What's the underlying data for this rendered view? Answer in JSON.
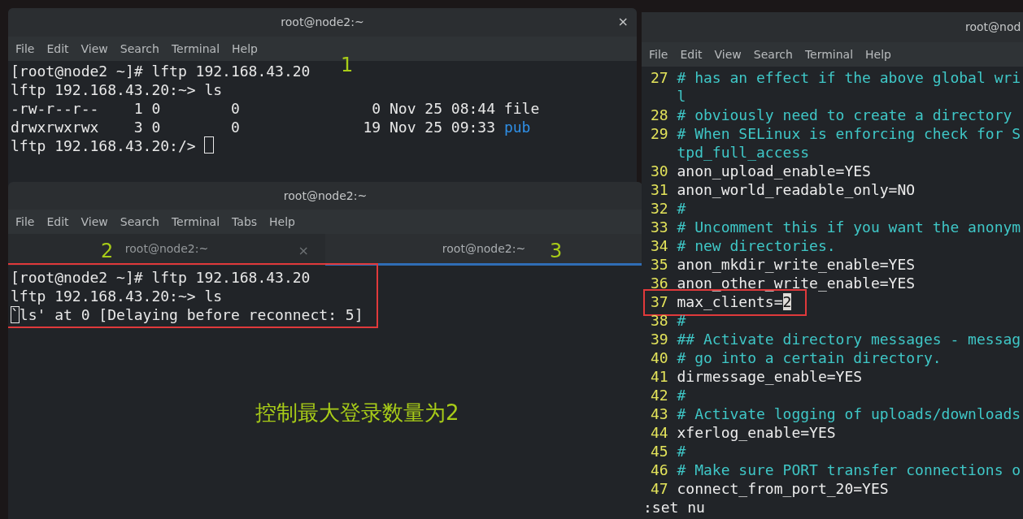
{
  "terminal_window_1": {
    "title": "root@node2:~",
    "close": "×",
    "menu": [
      "File",
      "Edit",
      "View",
      "Search",
      "Terminal",
      "Help"
    ],
    "annotation": "1",
    "lines": [
      {
        "segments": [
          {
            "text": "[root@node2 ~]# lftp 192.168.43.20",
            "kind": "plain"
          }
        ]
      },
      {
        "segments": [
          {
            "text": "lftp 192.168.43.20:~> ls",
            "kind": "plain"
          }
        ]
      },
      {
        "segments": [
          {
            "text": "-rw-r--r--    1 0        0               0 Nov 25 08:44 file",
            "kind": "plain"
          }
        ]
      },
      {
        "segments": [
          {
            "text": "drwxrwxrwx    3 0        0              19 Nov 25 09:33 ",
            "kind": "plain"
          },
          {
            "text": "pub",
            "kind": "dir"
          }
        ]
      },
      {
        "segments": [
          {
            "text": "lftp 192.168.43.20:/> ",
            "kind": "plain"
          }
        ],
        "cursor": true
      }
    ]
  },
  "terminal_window_2": {
    "title": "root@node2:~",
    "menu": [
      "File",
      "Edit",
      "View",
      "Search",
      "Terminal",
      "Tabs",
      "Help"
    ],
    "tabs": [
      {
        "label": "root@node2:~",
        "close": "×",
        "annotation": "2",
        "selected": false
      },
      {
        "label": "root@node2:~",
        "annotation": "3",
        "selected": true
      }
    ],
    "output": {
      "highlighted": true,
      "lines": [
        {
          "text": "[root@node2 ~]# lftp 192.168.43.20"
        },
        {
          "text": "lftp 192.168.43.20:~> ls"
        },
        {
          "text": "`ls' at 0 [Delaying before reconnect: 5]",
          "cursor": true
        }
      ]
    },
    "caption": "控制最大登录数量为2"
  },
  "editor_window": {
    "title": "root@nod",
    "menu": [
      "File",
      "Edit",
      "View",
      "Search",
      "Terminal",
      "Help"
    ],
    "lines": [
      {
        "number": "27",
        "text": "# has an effect if the above global wri",
        "kind": "comment",
        "highlighted": false
      },
      {
        "text": "l",
        "kind": "comment",
        "highlighted": false
      },
      {
        "number": "28",
        "text": "# obviously need to create a directory",
        "kind": "comment",
        "highlighted": false
      },
      {
        "number": "29",
        "text": "# When SELinux is enforcing check for S",
        "kind": "comment",
        "highlighted": false
      },
      {
        "text": "tpd_full_access",
        "kind": "comment",
        "highlighted": false
      },
      {
        "number": "30",
        "text": "anon_upload_enable=YES",
        "kind": "setting",
        "highlighted": false
      },
      {
        "number": "31",
        "text": "anon_world_readable_only=NO",
        "kind": "setting",
        "highlighted": false
      },
      {
        "number": "32",
        "text": "#",
        "kind": "comment",
        "highlighted": false
      },
      {
        "number": "33",
        "text": "# Uncomment this if you want the anonym",
        "kind": "comment",
        "highlighted": false
      },
      {
        "number": "34",
        "text": "# new directories.",
        "kind": "comment",
        "highlighted": false
      },
      {
        "number": "35",
        "text": "anon_mkdir_write_enable=YES",
        "kind": "setting",
        "highlighted": false
      },
      {
        "number": "36",
        "text": "anon_other_write_enable=YES",
        "kind": "setting",
        "highlighted": false
      },
      {
        "number": "37",
        "text": "max_clients=2",
        "kind": "setting",
        "highlighted": true,
        "cursor": true
      },
      {
        "number": "38",
        "text": "#",
        "kind": "comment",
        "highlighted": false
      },
      {
        "number": "39",
        "text": "## Activate directory messages - messag",
        "kind": "comment",
        "highlighted": false
      },
      {
        "number": "40",
        "text": "# go into a certain directory.",
        "kind": "comment",
        "highlighted": false
      },
      {
        "number": "41",
        "text": "dirmessage_enable=YES",
        "kind": "setting",
        "highlighted": false
      },
      {
        "number": "42",
        "text": "#",
        "kind": "comment",
        "highlighted": false
      },
      {
        "number": "43",
        "text": "# Activate logging of uploads/downloads",
        "kind": "comment",
        "highlighted": false
      },
      {
        "number": "44",
        "text": "xferlog_enable=YES",
        "kind": "setting",
        "highlighted": false
      },
      {
        "number": "45",
        "text": "#",
        "kind": "comment",
        "highlighted": false
      },
      {
        "number": "46",
        "text": "# Make sure PORT transfer connections o",
        "kind": "comment",
        "highlighted": false
      },
      {
        "number": "47",
        "text": "connect_from_port_20=YES",
        "kind": "setting",
        "highlighted": false
      }
    ],
    "command_line": ":set nu"
  }
}
